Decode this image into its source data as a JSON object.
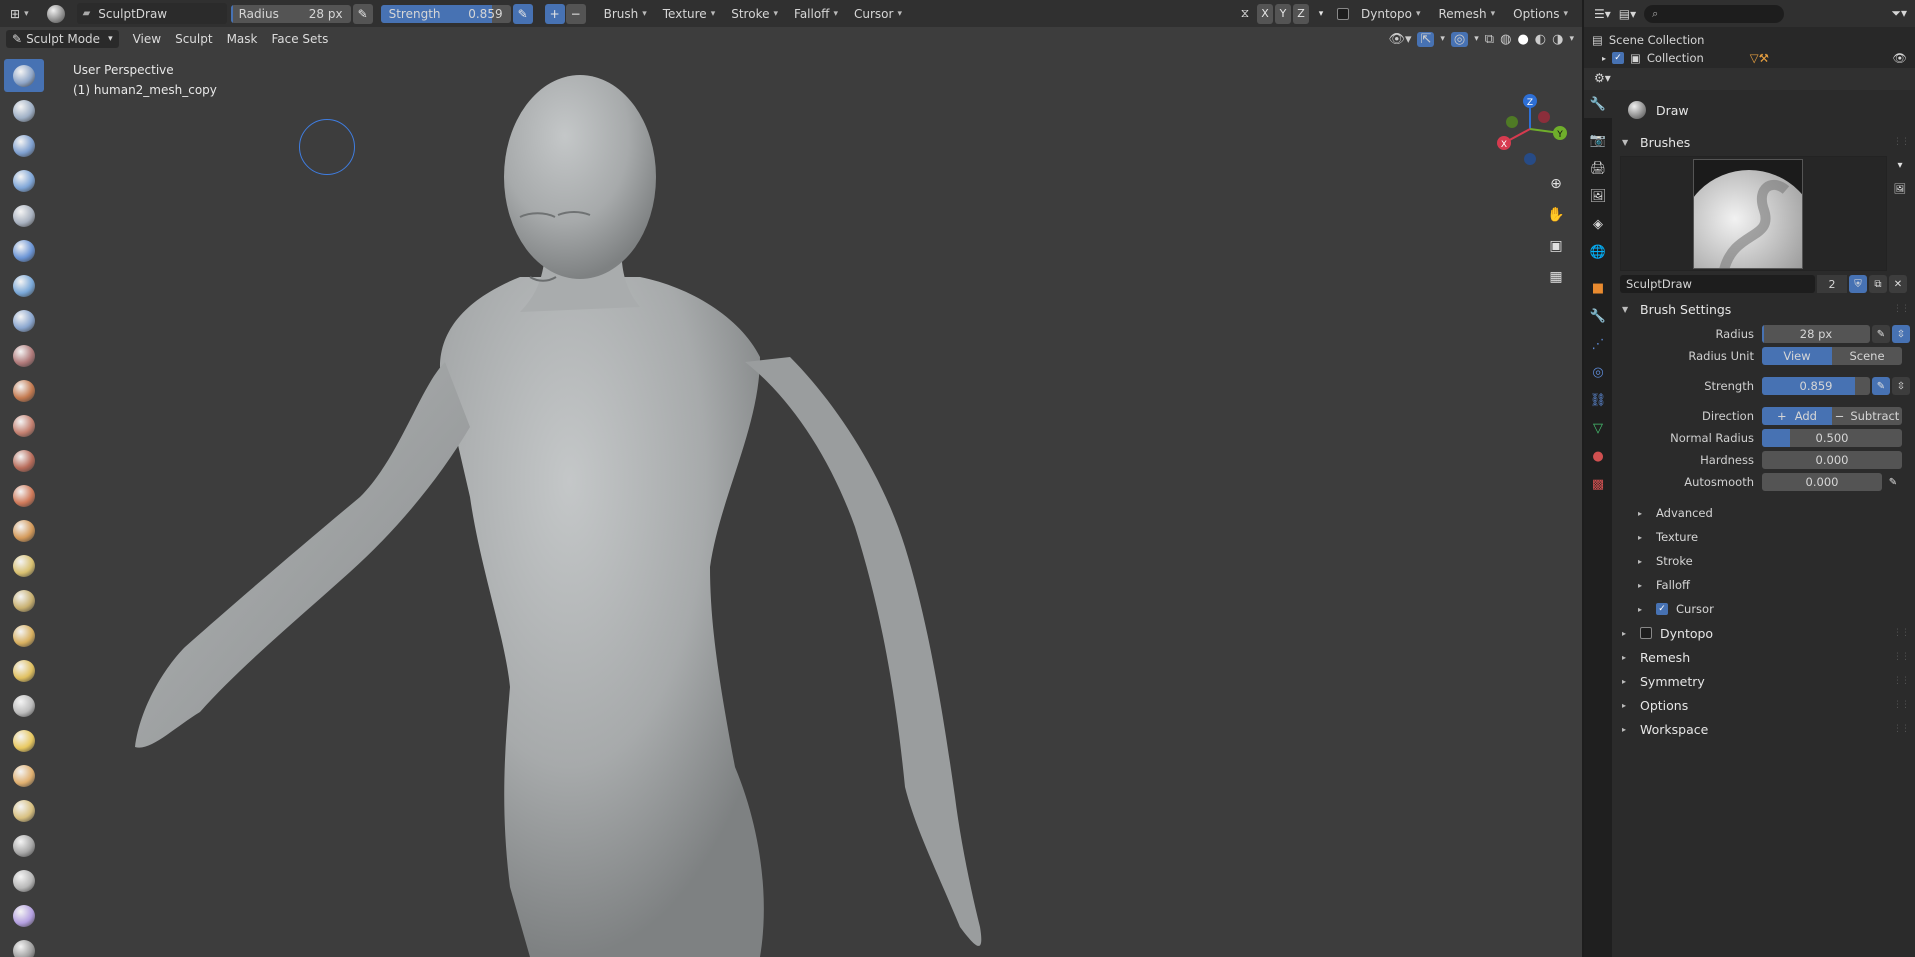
{
  "header": {
    "brush_name": "SculptDraw",
    "radius_label": "Radius",
    "radius_value": "28 px",
    "radius_fill": 0.5,
    "strength_label": "Strength",
    "strength_value": "0.859",
    "strength_fill": 0.859,
    "menus": [
      "Brush",
      "Texture",
      "Stroke",
      "Falloff",
      "Cursor"
    ],
    "axes": [
      "X",
      "Y",
      "Z"
    ],
    "dyntopo": "Dyntopo",
    "remesh": "Remesh",
    "options": "Options"
  },
  "header2": {
    "mode": "Sculpt Mode",
    "menus": [
      "View",
      "Sculpt",
      "Mask",
      "Face Sets"
    ]
  },
  "viewport": {
    "perspective": "User Perspective",
    "object": "(1) human2_mesh_copy",
    "gizmo": {
      "x": "X",
      "y": "Y",
      "z": "Z"
    }
  },
  "tools": [
    "draw-brush-icon",
    "draw-sharp-icon",
    "clay-icon",
    "clay-strips-icon",
    "clay-thumb-icon",
    "layer-icon",
    "inflate-icon",
    "blob-icon",
    "crease-icon",
    "smooth-icon",
    "flatten-icon",
    "fill-icon",
    "scrape-icon",
    "multiplane-scrape-icon",
    "pinch-icon",
    "grab-icon",
    "elastic-deform-icon",
    "snake-hook-icon",
    "thumb-icon",
    "pose-icon",
    "nudge-icon",
    "rotate-icon",
    "slide-relax-icon",
    "boundary-icon",
    "cloth-icon",
    "simplify-icon",
    "mask-icon"
  ],
  "outliner": {
    "scene_collection": "Scene Collection",
    "collection": "Collection"
  },
  "properties": {
    "brush_title": "Draw",
    "brushes_panel": "Brushes",
    "brush_datablock": "SculptDraw",
    "brush_users": "2",
    "brush_settings_panel": "Brush Settings",
    "rows": {
      "radius_label": "Radius",
      "radius_value": "28 px",
      "radius_fill": 0.5,
      "radius_unit_label": "Radius Unit",
      "radius_unit_view": "View",
      "radius_unit_scene": "Scene",
      "strength_label": "Strength",
      "strength_value": "0.859",
      "strength_fill": 0.859,
      "direction_label": "Direction",
      "direction_add": "Add",
      "direction_subtract": "Subtract",
      "normal_radius_label": "Normal Radius",
      "normal_radius_value": "0.500",
      "normal_radius_fill": 0.2,
      "hardness_label": "Hardness",
      "hardness_value": "0.000",
      "autosmooth_label": "Autosmooth",
      "autosmooth_value": "0.000"
    },
    "subpanels": [
      "Advanced",
      "Texture",
      "Stroke",
      "Falloff",
      "Cursor"
    ],
    "panels": [
      "Dyntopo",
      "Remesh",
      "Symmetry",
      "Options",
      "Workspace"
    ]
  },
  "colors": {
    "accent": "#4772b3",
    "panel_bg": "#2b2b2b",
    "viewport_bg": "#3d3d3d"
  }
}
